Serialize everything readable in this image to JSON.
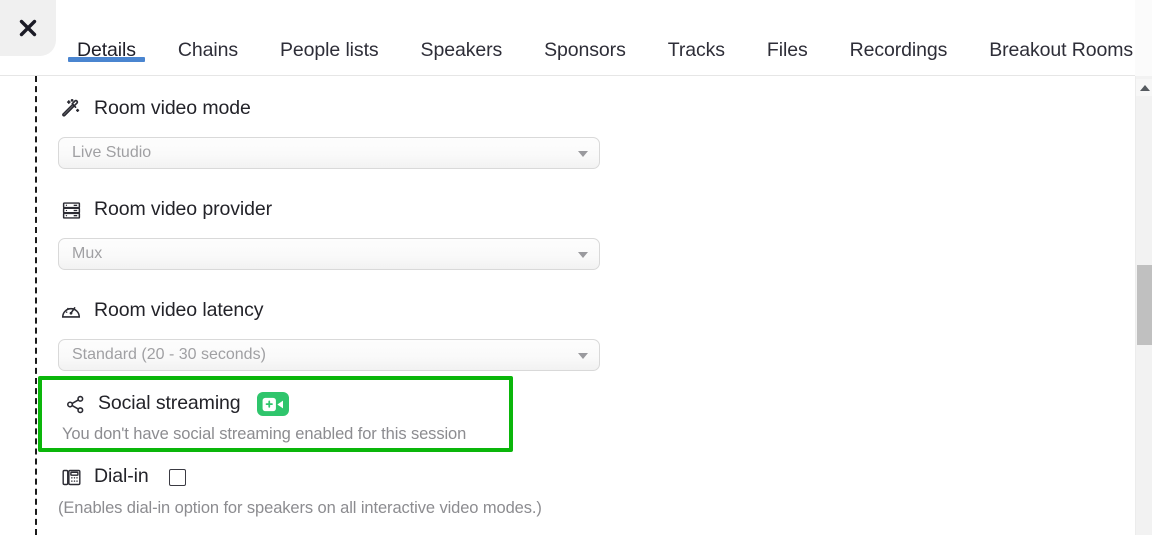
{
  "window": {
    "close_label": "Close",
    "close_icon": "close-x-icon"
  },
  "tabs": [
    {
      "label": "Details",
      "active": true
    },
    {
      "label": "Chains",
      "active": false
    },
    {
      "label": "People lists",
      "active": false
    },
    {
      "label": "Speakers",
      "active": false
    },
    {
      "label": "Sponsors",
      "active": false
    },
    {
      "label": "Tracks",
      "active": false
    },
    {
      "label": "Files",
      "active": false
    },
    {
      "label": "Recordings",
      "active": false
    },
    {
      "label": "Breakout Rooms",
      "active": false
    }
  ],
  "form": {
    "room_video_mode": {
      "icon": "magic-wand-icon",
      "label": "Room video mode",
      "value": "Live Studio"
    },
    "room_video_provider": {
      "icon": "server-rack-icon",
      "label": "Room video provider",
      "value": "Mux"
    },
    "room_video_latency": {
      "icon": "gauge-icon",
      "label": "Room video latency",
      "value": "Standard (20 - 30 seconds)"
    },
    "social_streaming": {
      "icon": "share-nodes-icon",
      "label": "Social streaming",
      "badge_icon": "add-video-icon",
      "description": "You don't have social streaming enabled for this session",
      "highlighted": true
    },
    "dial_in": {
      "icon": "desk-phone-icon",
      "label": "Dial-in",
      "checked": false,
      "description": "(Enables dial-in option for speakers on all interactive video modes.)"
    }
  },
  "scrollbar": {
    "up_arrow_icon": "chevron-up-icon",
    "thumb_label": "Vertical scroll thumb"
  },
  "colors": {
    "accent_blue": "#4a85d0",
    "highlight_green": "#0ab60a",
    "badge_green": "#2fc56c",
    "text_primary": "#232329",
    "text_muted": "#8c8c90",
    "placeholder": "#a0a0a3"
  }
}
